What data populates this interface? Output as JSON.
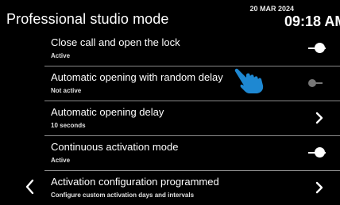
{
  "header": {
    "title": "Professional studio mode",
    "date": "20 MAR 2024",
    "time": "09:18 AM"
  },
  "colors": {
    "background": "#000000",
    "accent_hand": "#1e88d2",
    "toggle_inactive": "#777777",
    "divider": "#8a8a8a"
  },
  "settings": [
    {
      "label": "Close call and open the lock",
      "status": "Active",
      "control": "toggle-on"
    },
    {
      "label": "Automatic opening with random delay",
      "status": "Not active",
      "control": "toggle-off"
    },
    {
      "label": "Automatic opening delay",
      "status": "10 seconds",
      "control": "chevron-right-icon"
    },
    {
      "label": "Continuous activation mode",
      "status": "Active",
      "control": "toggle-on"
    },
    {
      "label": "Activation configuration programmed",
      "status": "Configure custom activation days and intervals",
      "control": "chevron-right-icon"
    }
  ],
  "icons": {
    "back": "chevron-left-icon",
    "pointer": "pointing-hand-icon"
  }
}
